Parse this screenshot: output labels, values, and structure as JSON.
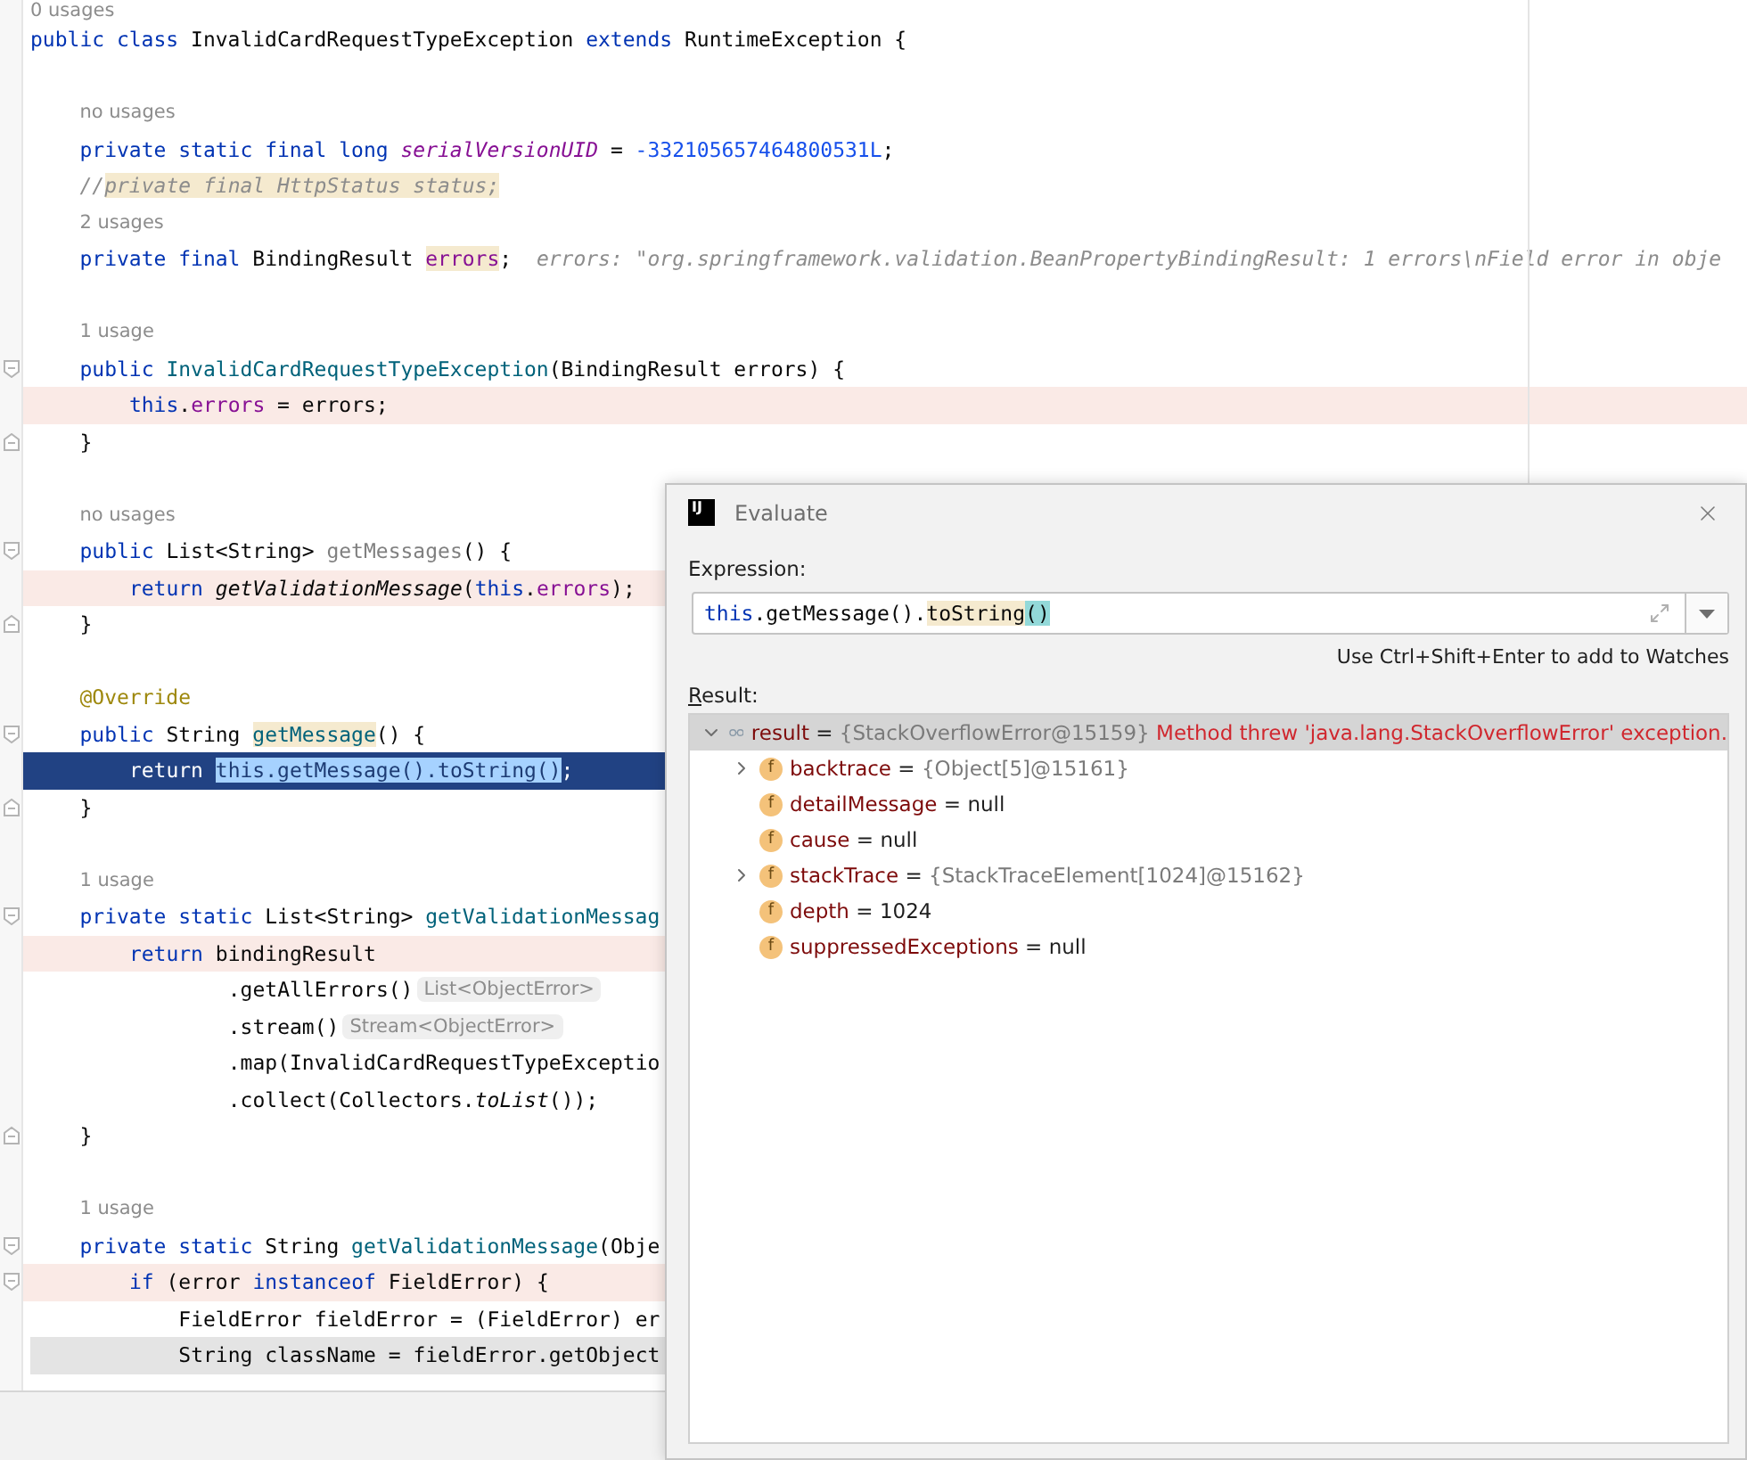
{
  "editor": {
    "lines": [
      {
        "kind": "hint",
        "text": "0 usages"
      },
      {
        "kind": "code",
        "segments": [
          {
            "text": "public class ",
            "kind": "kw"
          },
          {
            "text": "InvalidCardRequestTypeException ",
            "kind": "plain"
          },
          {
            "text": "extends ",
            "kind": "kw"
          },
          {
            "text": "RuntimeException {",
            "kind": "plain"
          }
        ]
      },
      {
        "kind": "blank"
      },
      {
        "kind": "hint",
        "text": "    no usages"
      },
      {
        "kind": "code",
        "segments": [
          {
            "text": "    private static final long ",
            "kind": "kw"
          },
          {
            "text": "serialVersionUID",
            "kind": "static-field"
          },
          {
            "text": " = ",
            "kind": "plain"
          },
          {
            "text": "-332105657464800531L",
            "kind": "number"
          },
          {
            "text": ";",
            "kind": "plain"
          }
        ]
      },
      {
        "kind": "code",
        "segments": [
          {
            "text": "    //",
            "kind": "comment"
          },
          {
            "text": "private final HttpStatus status;",
            "kind": "comment",
            "highlighted": true
          }
        ]
      },
      {
        "kind": "hint",
        "text": "    2 usages"
      },
      {
        "kind": "code",
        "segments": [
          {
            "text": "    private final ",
            "kind": "kw"
          },
          {
            "text": "BindingResult ",
            "kind": "plain"
          },
          {
            "text": "errors",
            "kind": "field",
            "highlighted": true
          },
          {
            "text": ";",
            "kind": "plain"
          },
          {
            "text": "errors: \"org.springframework.validation.BeanPropertyBindingResult: 1 errors\\nField error in obje",
            "kind": "inline-value"
          }
        ]
      },
      {
        "kind": "blank"
      },
      {
        "kind": "hint",
        "text": "    1 usage"
      },
      {
        "kind": "code",
        "fold_start": true,
        "segments": [
          {
            "text": "    public ",
            "kind": "kw"
          },
          {
            "text": "InvalidCardRequestTypeException",
            "kind": "decl"
          },
          {
            "text": "(BindingResult errors) {",
            "kind": "plain"
          }
        ]
      },
      {
        "kind": "code",
        "tinted": true,
        "segments": [
          {
            "text": "        this",
            "kind": "kw"
          },
          {
            "text": ".",
            "kind": "plain"
          },
          {
            "text": "errors",
            "kind": "field"
          },
          {
            "text": " = errors;",
            "kind": "plain"
          }
        ]
      },
      {
        "kind": "code",
        "fold_end": true,
        "segments": [
          {
            "text": "    }",
            "kind": "plain"
          }
        ]
      },
      {
        "kind": "blank"
      },
      {
        "kind": "hint",
        "text": "    no usages"
      },
      {
        "kind": "code",
        "fold_start": true,
        "segments": [
          {
            "text": "    public ",
            "kind": "kw"
          },
          {
            "text": "List<String> ",
            "kind": "plain"
          },
          {
            "text": "getMessages",
            "kind": "unused"
          },
          {
            "text": "() {",
            "kind": "plain"
          }
        ]
      },
      {
        "kind": "code",
        "tinted": true,
        "segments": [
          {
            "text": "        return ",
            "kind": "kw"
          },
          {
            "text": "getValidationMessage",
            "kind": "static-call"
          },
          {
            "text": "(",
            "kind": "plain"
          },
          {
            "text": "this",
            "kind": "kw"
          },
          {
            "text": ".",
            "kind": "plain"
          },
          {
            "text": "errors",
            "kind": "field"
          },
          {
            "text": ");",
            "kind": "plain"
          }
        ]
      },
      {
        "kind": "code",
        "fold_end": true,
        "segments": [
          {
            "text": "    }",
            "kind": "plain"
          }
        ]
      },
      {
        "kind": "blank"
      },
      {
        "kind": "code",
        "segments": [
          {
            "text": "    @Override",
            "kind": "annotation"
          }
        ]
      },
      {
        "kind": "code",
        "fold_start": true,
        "segments": [
          {
            "text": "    public ",
            "kind": "kw"
          },
          {
            "text": "String ",
            "kind": "plain"
          },
          {
            "text": "getMessage",
            "kind": "decl",
            "highlighted": true
          },
          {
            "text": "() {",
            "kind": "plain"
          }
        ]
      },
      {
        "kind": "code",
        "current": true,
        "segments": [
          {
            "text": "        return ",
            "kind": "kw"
          },
          {
            "text": "this.getMessage().toString()",
            "kind": "plain",
            "selected": true
          },
          {
            "text": ";",
            "kind": "plain"
          }
        ]
      },
      {
        "kind": "code",
        "fold_end": true,
        "segments": [
          {
            "text": "    }",
            "kind": "plain"
          }
        ]
      },
      {
        "kind": "blank"
      },
      {
        "kind": "hint",
        "text": "    1 usage"
      },
      {
        "kind": "code",
        "fold_start": true,
        "segments": [
          {
            "text": "    private static ",
            "kind": "kw"
          },
          {
            "text": "List<String> ",
            "kind": "plain"
          },
          {
            "text": "getValidationMessag",
            "kind": "decl"
          }
        ]
      },
      {
        "kind": "code",
        "tinted": true,
        "segments": [
          {
            "text": "        return ",
            "kind": "kw"
          },
          {
            "text": "bindingResult",
            "kind": "plain"
          }
        ]
      },
      {
        "kind": "code",
        "segments": [
          {
            "text": "                .getAllErrors()",
            "kind": "plain"
          },
          {
            "text": "List<ObjectError>",
            "kind": "type-hint"
          }
        ]
      },
      {
        "kind": "code",
        "segments": [
          {
            "text": "                .stream()",
            "kind": "plain"
          },
          {
            "text": "Stream<ObjectError>",
            "kind": "type-hint"
          }
        ]
      },
      {
        "kind": "code",
        "segments": [
          {
            "text": "                .map(InvalidCardRequestTypeExceptio",
            "kind": "plain"
          }
        ]
      },
      {
        "kind": "code",
        "segments": [
          {
            "text": "                .collect(Collectors.",
            "kind": "plain"
          },
          {
            "text": "toList",
            "kind": "static-call"
          },
          {
            "text": "());",
            "kind": "plain"
          }
        ]
      },
      {
        "kind": "code",
        "fold_end": true,
        "segments": [
          {
            "text": "    }",
            "kind": "plain"
          }
        ]
      },
      {
        "kind": "blank"
      },
      {
        "kind": "hint",
        "text": "    1 usage"
      },
      {
        "kind": "code",
        "fold_start": true,
        "segments": [
          {
            "text": "    private static ",
            "kind": "kw"
          },
          {
            "text": "String ",
            "kind": "plain"
          },
          {
            "text": "getValidationMessage",
            "kind": "decl"
          },
          {
            "text": "(Obje",
            "kind": "plain"
          }
        ]
      },
      {
        "kind": "code",
        "fold_start": true,
        "tinted": true,
        "segments": [
          {
            "text": "        if ",
            "kind": "kw"
          },
          {
            "text": "(error ",
            "kind": "plain"
          },
          {
            "text": "instanceof ",
            "kind": "kw"
          },
          {
            "text": "FieldError) {",
            "kind": "plain"
          }
        ]
      },
      {
        "kind": "code",
        "segments": [
          {
            "text": "            FieldError fieldError = (FieldError) er",
            "kind": "plain"
          }
        ]
      },
      {
        "kind": "code",
        "caret": true,
        "segments": [
          {
            "text": "            String className = fieldError.getObject",
            "kind": "plain"
          }
        ]
      }
    ]
  },
  "evaluate_dialog": {
    "app_icon_text": "IJ",
    "title": "Evaluate",
    "expression_label": "Expression:",
    "expression": [
      {
        "text": "this",
        "kind": "kw"
      },
      {
        "text": ".getMessage().",
        "kind": "plain"
      },
      {
        "text": "toString",
        "kind": "plain",
        "highlighted": true
      },
      {
        "text": "()",
        "kind": "plain",
        "brace_match": true
      }
    ],
    "hint": "Use Ctrl+Shift+Enter to add to Watches",
    "result_label": "Result:",
    "result": {
      "name": "result",
      "operator": "=",
      "value": "{StackOverflowError@15159}",
      "kind": "ref",
      "message": "Method threw 'java.lang.StackOverflowError' exception.",
      "expanded": true,
      "selected": true,
      "children": [
        {
          "icon_letter": "f",
          "name": "backtrace",
          "operator": "=",
          "value": "{Object[5]@15161}",
          "kind": "ref",
          "expanded": false,
          "selected": false
        },
        {
          "icon_letter": "f",
          "name": "detailMessage",
          "operator": "=",
          "value": "null",
          "kind": "plain",
          "selected": false
        },
        {
          "icon_letter": "f",
          "name": "cause",
          "operator": "=",
          "value": "null",
          "kind": "plain",
          "selected": false
        },
        {
          "icon_letter": "f",
          "name": "stackTrace",
          "operator": "=",
          "value": "{StackTraceElement[1024]@15162}",
          "kind": "ref",
          "expanded": false,
          "selected": false
        },
        {
          "icon_letter": "f",
          "name": "depth",
          "operator": "=",
          "value": "1024",
          "kind": "plain",
          "selected": false
        },
        {
          "icon_letter": "f",
          "name": "suppressedExceptions",
          "operator": "=",
          "value": "null",
          "kind": "plain",
          "selected": false
        }
      ]
    }
  }
}
